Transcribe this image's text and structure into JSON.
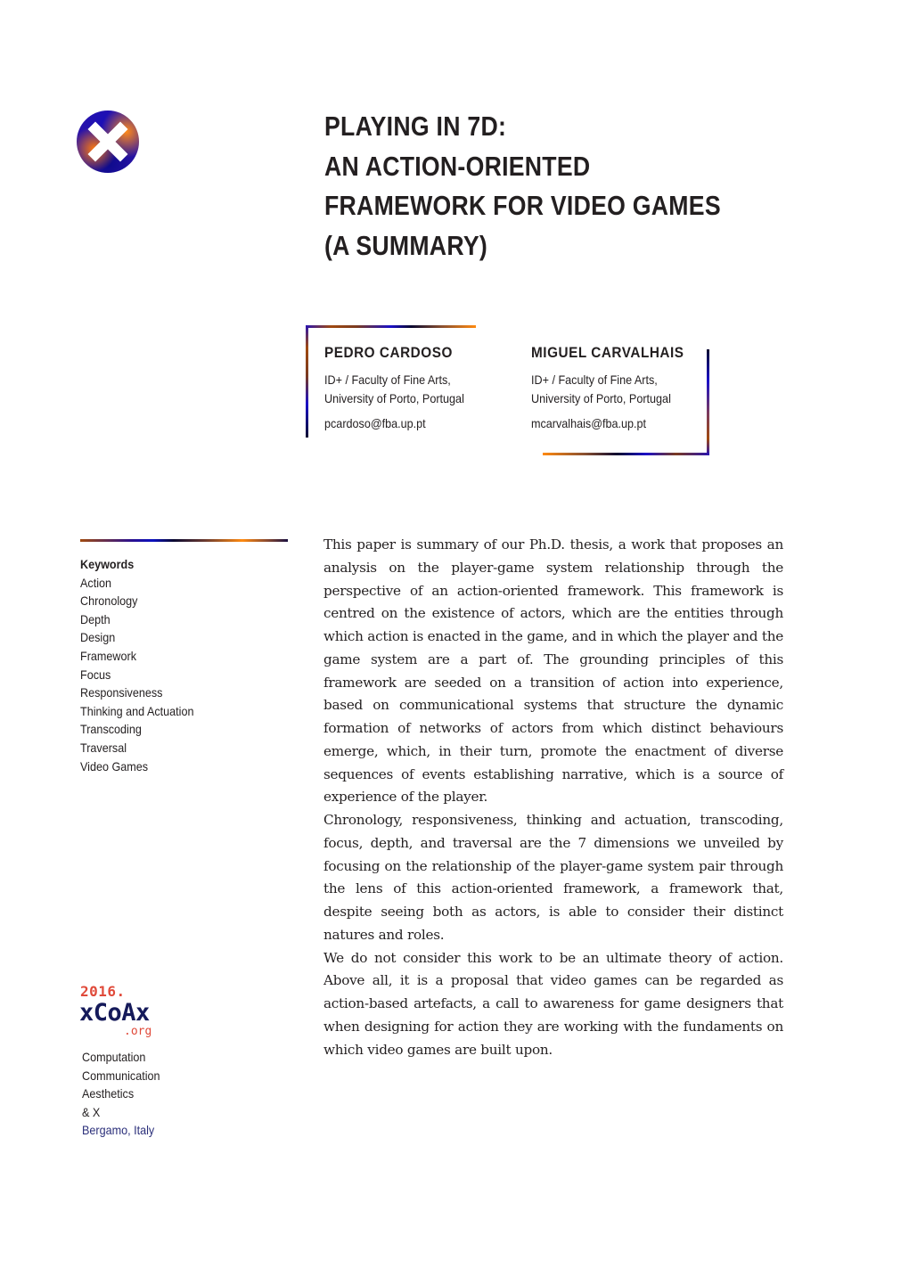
{
  "logo": {
    "icon": "xcoax-x-logo-icon"
  },
  "title": {
    "lines": [
      "PLAYING IN 7D:",
      "AN ACTION-ORIENTED",
      "FRAMEWORK FOR VIDEO GAMES",
      "(A SUMMARY)"
    ]
  },
  "authors": [
    {
      "name": "PEDRO CARDOSO",
      "affiliation_line1": "ID+ / Faculty of Fine Arts,",
      "affiliation_line2": "University of Porto, Portugal",
      "email": "pcardoso@fba.up.pt"
    },
    {
      "name": "MIGUEL CARVALHAIS",
      "affiliation_line1": "ID+ / Faculty of Fine Arts,",
      "affiliation_line2": "University of Porto, Portugal",
      "email": "mcarvalhais@fba.up.pt"
    }
  ],
  "keywords": {
    "heading": "Keywords",
    "items": [
      "Action",
      "Chronology",
      "Depth",
      "Design",
      "Framework",
      "Focus",
      "Responsiveness",
      "Thinking and Actuation",
      "Transcoding",
      "Traversal",
      "Video Games"
    ]
  },
  "conference": {
    "year": "2016.",
    "name": "xCoAx",
    "tld": ".org",
    "lines": [
      "Computation",
      "Communication",
      "Aesthetics",
      "& X"
    ],
    "location": "Bergamo, Italy"
  },
  "abstract": {
    "paragraphs": [
      "This paper is summary of our Ph.D. thesis, a work that proposes an analysis on the player-game system relationship through the perspective of an action-oriented framework. This framework is centred on the existence of actors, which are the entities through which action is enacted in the game, and in which the player and the game system are a part of. The grounding principles of this framework are seeded on a transition of action into experience, based on communicational systems that structure the dynamic formation of networks of actors from which distinct behaviours emerge, which, in their turn, promote the enactment of diverse sequences of events establishing narrative, which is a source of experience of the player.",
      "Chronology, responsiveness, thinking and actuation, transcod­ing, focus, depth, and traversal are the 7 dimensions we unveiled by focusing on the relationship of the player-game system pair through the lens of this action-oriented framework, a framework that, despite seeing both as actors, is able to consider their dis­tinct natures and roles.",
      "We do not consider this work to be an ultimate theory of action. Above all, it is a proposal that video games can be regarded as action-based artefacts, a call to awareness for game designers that when designing for action they are working with the funda­ments on which video games are built upon."
    ]
  },
  "colors": {
    "text": "#231f20",
    "accent_orange": "#ff8a10",
    "accent_blue": "#1a10c8",
    "accent_navy": "#0a0830",
    "xcoax_red": "#e04a3a",
    "xcoax_navy": "#151a5a",
    "location_blue": "#2b2f7a"
  }
}
